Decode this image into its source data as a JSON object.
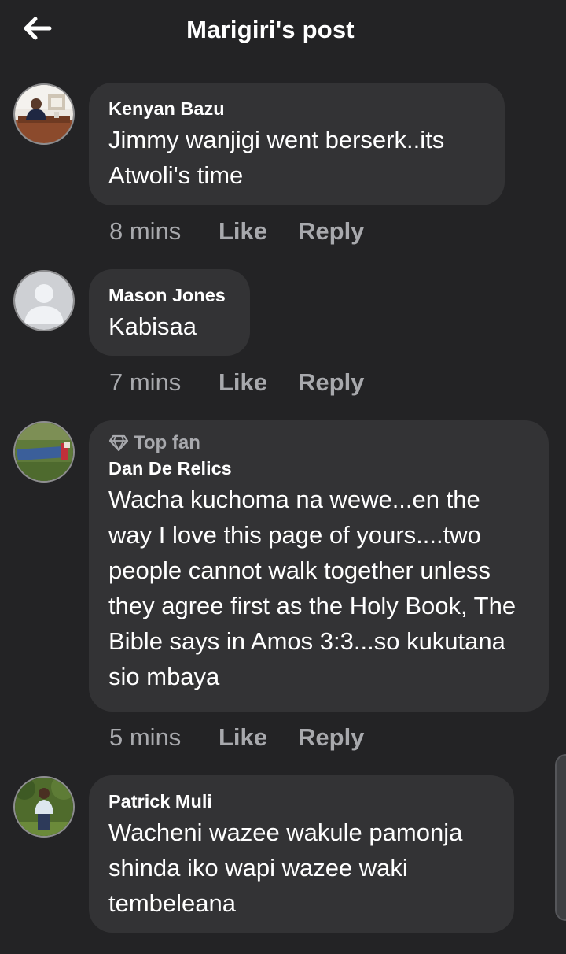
{
  "header": {
    "title": "Marigiri's post",
    "back_icon": "arrow-left-icon"
  },
  "comments": [
    {
      "author": "Kenyan Bazu",
      "text": "Jimmy wanjigi went berserk..its Atwoli's time",
      "time": "8 mins",
      "like": "Like",
      "reply": "Reply"
    },
    {
      "author": "Mason Jones",
      "text": "Kabisaa",
      "time": "7 mins",
      "like": "Like",
      "reply": "Reply"
    },
    {
      "badge": "Top fan",
      "badge_icon": "diamond-icon",
      "author": "Dan De Relics",
      "text": "Wacha kuchoma na wewe...en the way I love this page of yours....two people cannot walk together unless they agree first as the Holy Book, The Bible says in Amos 3:3...so kukutana  sio mbaya",
      "time": "5 mins",
      "like": "Like",
      "reply": "Reply"
    },
    {
      "author": "Patrick Muli",
      "text": "Wacheni wazee wakule pamonja shinda iko wapi wazee waki tembeleana"
    }
  ],
  "colors": {
    "background": "#232325",
    "bubble": "#333335",
    "meta_text": "#a8a9ad",
    "text": "#ffffff"
  }
}
